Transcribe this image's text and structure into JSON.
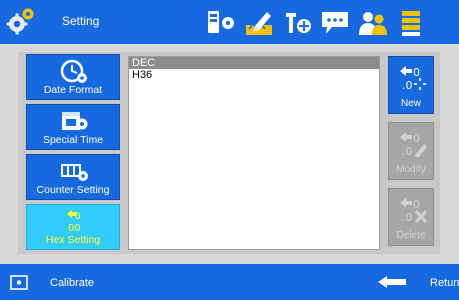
{
  "header": {
    "title": "Setting",
    "icons": [
      "gears-icon",
      "device-settings-icon",
      "pen-edit-icon",
      "wrench-settings-icon",
      "chat-icon",
      "users-icon",
      "list-menu-icon"
    ]
  },
  "sidebar": {
    "items": [
      {
        "label": "Date Format",
        "icon": "calendar-clock-icon",
        "active": false
      },
      {
        "label": "Special Time",
        "icon": "calendar-gear-icon",
        "active": false
      },
      {
        "label": "Counter Setting",
        "icon": "counter-gear-icon",
        "active": false
      },
      {
        "label": "Hex Setting",
        "icon": "hex-digits-icon",
        "active": true
      }
    ]
  },
  "list": {
    "items": [
      {
        "label": "DEC",
        "selected": true
      },
      {
        "label": "H36",
        "selected": false
      }
    ]
  },
  "actions": {
    "new": {
      "label": "New",
      "enabled": true
    },
    "modify": {
      "label": "Modify",
      "enabled": false
    },
    "delete": {
      "label": "Delete",
      "enabled": false
    }
  },
  "footer": {
    "calibrate_label": "Calibrate",
    "return_label": "Return"
  },
  "colors": {
    "bar_blue": "#1769e0",
    "active_cyan": "#33ccff",
    "active_text": "#ffff33",
    "disabled_gray": "#a6a6a6",
    "panel_gray": "#c8c8c8"
  }
}
